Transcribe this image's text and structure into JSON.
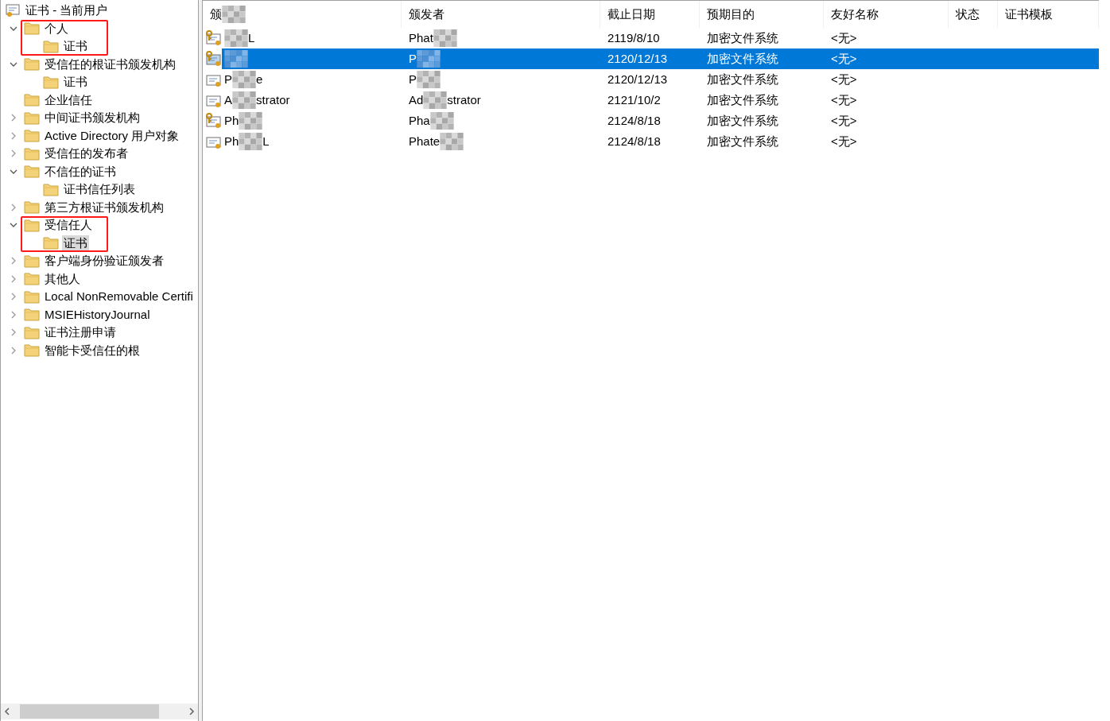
{
  "tree": {
    "root": {
      "label": "证书 - 当前用户"
    },
    "items": [
      {
        "label": "个人",
        "kind": "branch",
        "expanded": true,
        "selected": false,
        "highlighted": true,
        "children": [
          {
            "label": "证书",
            "kind": "leaf",
            "selected": false,
            "highlighted": false
          }
        ]
      },
      {
        "label": "受信任的根证书颁发机构",
        "kind": "branch",
        "expanded": true,
        "selected": false,
        "highlighted": false,
        "children": [
          {
            "label": "证书",
            "kind": "leaf",
            "selected": false,
            "highlighted": false
          }
        ]
      },
      {
        "label": "企业信任",
        "kind": "leaf",
        "selected": false,
        "highlighted": false
      },
      {
        "label": "中间证书颁发机构",
        "kind": "branch",
        "expanded": false,
        "selected": false,
        "highlighted": false
      },
      {
        "label": "Active Directory 用户对象",
        "kind": "branch",
        "expanded": false,
        "selected": false,
        "highlighted": false
      },
      {
        "label": "受信任的发布者",
        "kind": "branch",
        "expanded": false,
        "selected": false,
        "highlighted": false
      },
      {
        "label": "不信任的证书",
        "kind": "branch",
        "expanded": true,
        "selected": false,
        "highlighted": false,
        "children": [
          {
            "label": "证书信任列表",
            "kind": "leaf",
            "selected": false,
            "highlighted": false
          }
        ]
      },
      {
        "label": "第三方根证书颁发机构",
        "kind": "branch",
        "expanded": false,
        "selected": false,
        "highlighted": false
      },
      {
        "label": "受信任人",
        "kind": "branch",
        "expanded": true,
        "selected": false,
        "highlighted": true,
        "children": [
          {
            "label": "证书",
            "kind": "leaf",
            "selected": true,
            "highlighted": false
          }
        ]
      },
      {
        "label": "客户端身份验证颁发者",
        "kind": "branch",
        "expanded": false,
        "selected": false,
        "highlighted": false
      },
      {
        "label": "其他人",
        "kind": "branch",
        "expanded": false,
        "selected": false,
        "highlighted": false
      },
      {
        "label": "Local NonRemovable Certifi",
        "kind": "branch",
        "expanded": false,
        "selected": false,
        "highlighted": false
      },
      {
        "label": "MSIEHistoryJournal",
        "kind": "branch",
        "expanded": false,
        "selected": false,
        "highlighted": false
      },
      {
        "label": "证书注册申请",
        "kind": "branch",
        "expanded": false,
        "selected": false,
        "highlighted": false
      },
      {
        "label": "智能卡受信任的根",
        "kind": "branch",
        "expanded": false,
        "selected": false,
        "highlighted": false
      }
    ]
  },
  "table": {
    "columns": [
      {
        "start": "颁",
        "redacted": true
      },
      {
        "start": "颁发者",
        "redacted": false
      },
      {
        "start": "截止日期",
        "redacted": false
      },
      {
        "start": "预期目的",
        "redacted": false
      },
      {
        "start": "友好名称",
        "redacted": false
      },
      {
        "start": "状态",
        "redacted": false
      },
      {
        "start": "证书模板",
        "redacted": false
      }
    ],
    "rows": [
      {
        "kind": "key_cert",
        "selected": false,
        "issued_to": {
          "end": "L",
          "redacted": true
        },
        "issued_by": {
          "start": "Phat",
          "redacted": true
        },
        "expires": "2119/8/10",
        "purpose": "加密文件系统",
        "friendly_name": "<无>"
      },
      {
        "kind": "key_cert",
        "selected": true,
        "issued_to": {
          "redacted": true
        },
        "issued_by": {
          "start": "P",
          "redacted": true
        },
        "expires": "2120/12/13",
        "purpose": "加密文件系统",
        "friendly_name": "<无>"
      },
      {
        "kind": "cert",
        "selected": false,
        "issued_to": {
          "start": "P",
          "end": "e",
          "redacted": true
        },
        "issued_by": {
          "start": "P",
          "redacted": true
        },
        "expires": "2120/12/13",
        "purpose": "加密文件系统",
        "friendly_name": "<无>"
      },
      {
        "kind": "cert",
        "selected": false,
        "issued_to": {
          "start": "A",
          "end": "strator",
          "redacted": true
        },
        "issued_by": {
          "start": "Ad",
          "end": "strator",
          "redacted": true
        },
        "expires": "2121/10/2",
        "purpose": "加密文件系统",
        "friendly_name": "<无>"
      },
      {
        "kind": "key_cert",
        "selected": false,
        "issued_to": {
          "start": "Ph",
          "redacted": true
        },
        "issued_by": {
          "start": "Pha",
          "redacted": true
        },
        "expires": "2124/8/18",
        "purpose": "加密文件系统",
        "friendly_name": "<无>"
      },
      {
        "kind": "cert",
        "selected": false,
        "issued_to": {
          "start": "Ph",
          "end": "L",
          "redacted": true
        },
        "issued_by": {
          "start": "Phate",
          "redacted": true
        },
        "expires": "2124/8/18",
        "purpose": "加密文件系统",
        "friendly_name": "<无>"
      }
    ]
  }
}
